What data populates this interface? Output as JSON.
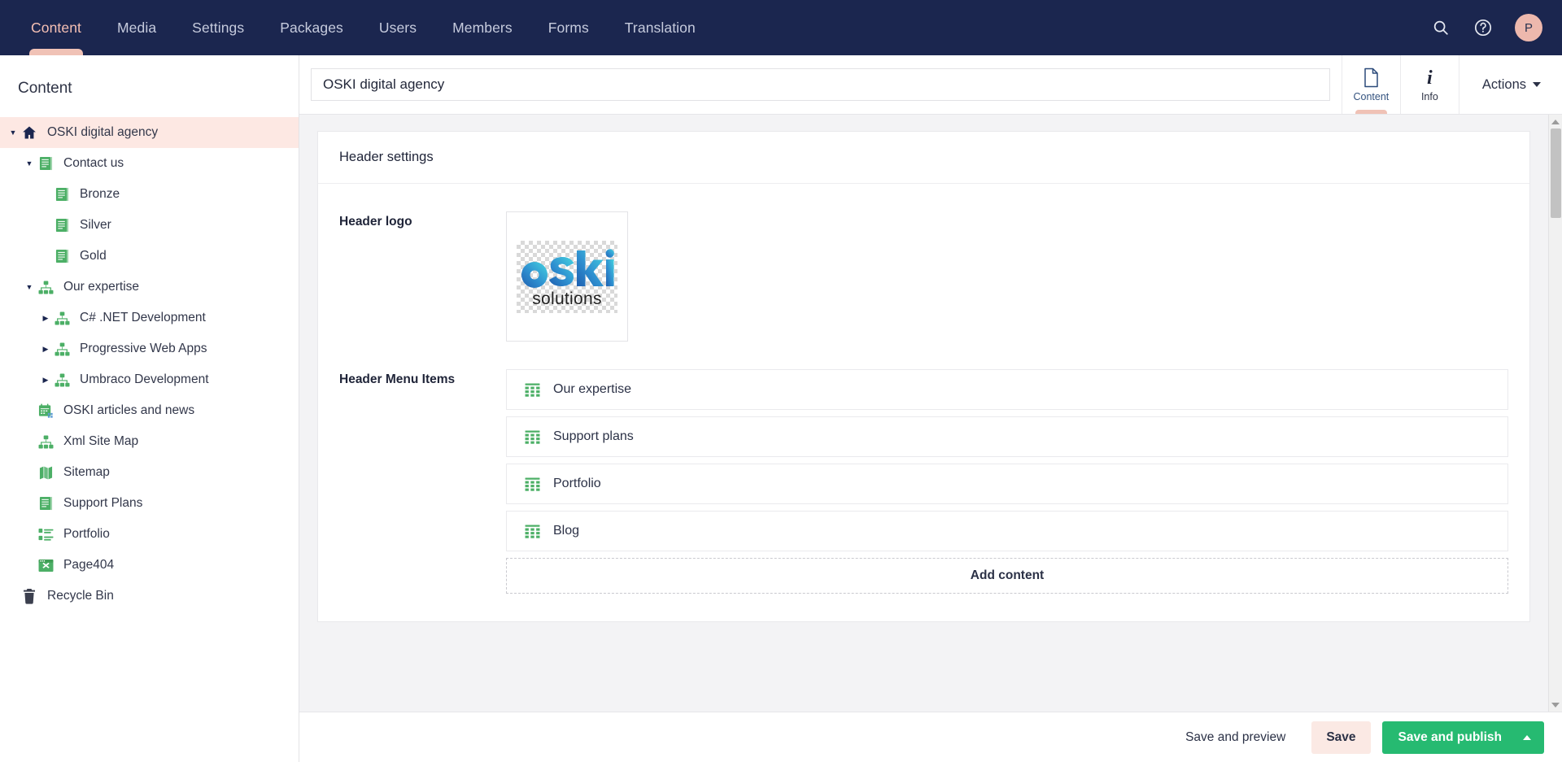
{
  "topnav": {
    "items": [
      {
        "label": "Content",
        "active": true
      },
      {
        "label": "Media",
        "active": false
      },
      {
        "label": "Settings",
        "active": false
      },
      {
        "label": "Packages",
        "active": false
      },
      {
        "label": "Users",
        "active": false
      },
      {
        "label": "Members",
        "active": false
      },
      {
        "label": "Forms",
        "active": false
      },
      {
        "label": "Translation",
        "active": false
      }
    ],
    "search_icon": "search-icon",
    "help_icon": "help-circle-icon",
    "avatar_initial": "P"
  },
  "sidebar": {
    "title": "Content",
    "tree": [
      {
        "label": "OSKI digital agency",
        "depth": 0,
        "icon": "home-icon",
        "caret": "down",
        "selected": true
      },
      {
        "label": "Contact us",
        "depth": 1,
        "icon": "document-icon",
        "caret": "down",
        "selected": false
      },
      {
        "label": "Bronze",
        "depth": 2,
        "icon": "document-icon",
        "caret": "none",
        "selected": false
      },
      {
        "label": "Silver",
        "depth": 2,
        "icon": "document-icon",
        "caret": "none",
        "selected": false
      },
      {
        "label": "Gold",
        "depth": 2,
        "icon": "document-icon",
        "caret": "none",
        "selected": false
      },
      {
        "label": "Our expertise",
        "depth": 1,
        "icon": "sitemap-icon",
        "caret": "down",
        "selected": false
      },
      {
        "label": "C# .NET Development",
        "depth": 2,
        "icon": "sitemap-icon",
        "caret": "right",
        "selected": false
      },
      {
        "label": "Progressive Web Apps",
        "depth": 2,
        "icon": "sitemap-icon",
        "caret": "right",
        "selected": false
      },
      {
        "label": "Umbraco Development",
        "depth": 2,
        "icon": "sitemap-icon",
        "caret": "right",
        "selected": false
      },
      {
        "label": "OSKI articles and news",
        "depth": 1,
        "icon": "calendar-icon",
        "caret": "none",
        "selected": false
      },
      {
        "label": "Xml Site Map",
        "depth": 1,
        "icon": "sitemap-icon",
        "caret": "none",
        "selected": false
      },
      {
        "label": "Sitemap",
        "depth": 1,
        "icon": "map-icon",
        "caret": "none",
        "selected": false
      },
      {
        "label": "Support Plans",
        "depth": 1,
        "icon": "document-icon",
        "caret": "none",
        "selected": false
      },
      {
        "label": "Portfolio",
        "depth": 1,
        "icon": "list-icon",
        "caret": "none",
        "selected": false
      },
      {
        "label": "Page404",
        "depth": 1,
        "icon": "browser-x-icon",
        "caret": "none",
        "selected": false
      },
      {
        "label": "Recycle Bin",
        "depth": 0,
        "icon": "trash-icon",
        "caret": "none",
        "selected": false
      }
    ]
  },
  "editor": {
    "title_value": "OSKI digital agency",
    "title_placeholder": "Enter a name...",
    "tabs": [
      {
        "label": "Content",
        "icon": "document-outline-icon",
        "active": true
      },
      {
        "label": "Info",
        "icon": "info-italic-icon",
        "active": false
      }
    ],
    "actions_label": "Actions"
  },
  "panel": {
    "header": "Header settings",
    "properties": [
      {
        "label": "Header logo"
      },
      {
        "label": "Header Menu Items"
      }
    ],
    "logo": {
      "alt": "oSKi solutions",
      "word_mark": "oSKi",
      "sub_text": "solutions"
    },
    "menu_items": [
      {
        "label": "Our expertise",
        "icon": "grid-icon"
      },
      {
        "label": "Support plans",
        "icon": "grid-icon"
      },
      {
        "label": "Portfolio",
        "icon": "grid-icon"
      },
      {
        "label": "Blog",
        "icon": "grid-icon"
      }
    ],
    "add_content_label": "Add content"
  },
  "footer": {
    "save_and_preview": "Save and preview",
    "save": "Save",
    "save_and_publish": "Save and publish"
  },
  "colors": {
    "nav_background": "#1b264f",
    "accent_pink": "#f0c2b6",
    "selected_row": "#fde8e3",
    "publish_green": "#26ba71",
    "tree_icon_green": "#4caf66"
  }
}
